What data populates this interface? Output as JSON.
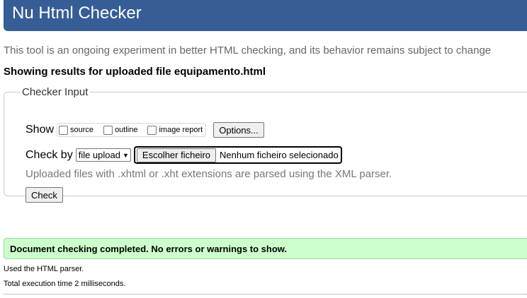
{
  "header": {
    "title": "Nu Html Checker"
  },
  "intro_text": "This tool is an ongoing experiment in better HTML checking, and its behavior remains subject to change",
  "results_heading": "Showing results for uploaded file equipamento.html",
  "checker_input": {
    "legend": "Checker Input",
    "show_label": "Show",
    "options": {
      "source": "source",
      "outline": "outline",
      "image_report": "image report"
    },
    "options_button": "Options...",
    "check_by_label": "Check by",
    "check_by_selected": "file upload",
    "file_button": "Escolher ficheiro",
    "file_status": "Nenhum ficheiro selecionado",
    "parser_note": "Uploaded files with .xhtml or .xht extensions are parsed using the XML parser.",
    "check_button": "Check"
  },
  "result": {
    "message": "Document checking completed. No errors or warnings to show.",
    "colors": {
      "background": "#ccffcc",
      "border": "#99dd99"
    }
  },
  "details": {
    "parser_used": "Used the HTML parser.",
    "execution_time": "Total execution time 2 milliseconds."
  },
  "colors": {
    "header_background": "#365d95",
    "header_text": "#ffffff"
  }
}
